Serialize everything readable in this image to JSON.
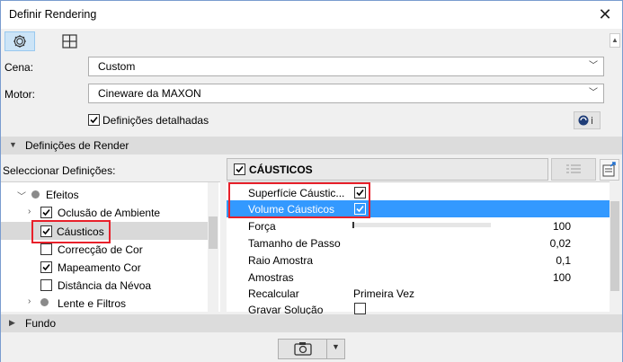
{
  "window": {
    "title": "Definir Rendering"
  },
  "toolbar": {
    "tabs": [
      {
        "icon": "gear-icon"
      },
      {
        "icon": "grid-icon"
      }
    ]
  },
  "scene": {
    "label": "Cena:",
    "value": "Custom"
  },
  "engine": {
    "label": "Motor:",
    "value": "Cineware da MAXON"
  },
  "detailed": {
    "label": "Definições detalhadas",
    "checked": true
  },
  "render_section": {
    "title": "Definições de Render"
  },
  "select_settings": {
    "label": "Seleccionar Definições:"
  },
  "tree": {
    "items": [
      {
        "label": "Efeitos",
        "type": "group"
      },
      {
        "label": "Oclusão de Ambiente",
        "checked": true
      },
      {
        "label": "Cáusticos",
        "checked": true,
        "selected": true
      },
      {
        "label": "Correcção de Cor",
        "checked": false
      },
      {
        "label": "Mapeamento Cor",
        "checked": true
      },
      {
        "label": "Distância da Névoa",
        "checked": false
      },
      {
        "label": "Lente e Filtros",
        "type": "group"
      }
    ]
  },
  "panel": {
    "title": "CÁUSTICOS",
    "checked": true
  },
  "props": [
    {
      "name": "Superfície Cáustic...",
      "checked": true
    },
    {
      "name": "Volume Cáusticos",
      "checked": true,
      "selected": true
    },
    {
      "name": "Força",
      "value": "100",
      "slider": 1.0
    },
    {
      "name": "Tamanho de Passo",
      "value": "0,02"
    },
    {
      "name": "Raio Amostra",
      "value": "0,1"
    },
    {
      "name": "Amostras",
      "value": "100"
    },
    {
      "name": "Recalcular",
      "value": "Primeira Vez"
    },
    {
      "name": "Gravar Solução",
      "checked": false
    }
  ],
  "background_section": {
    "title": "Fundo"
  }
}
